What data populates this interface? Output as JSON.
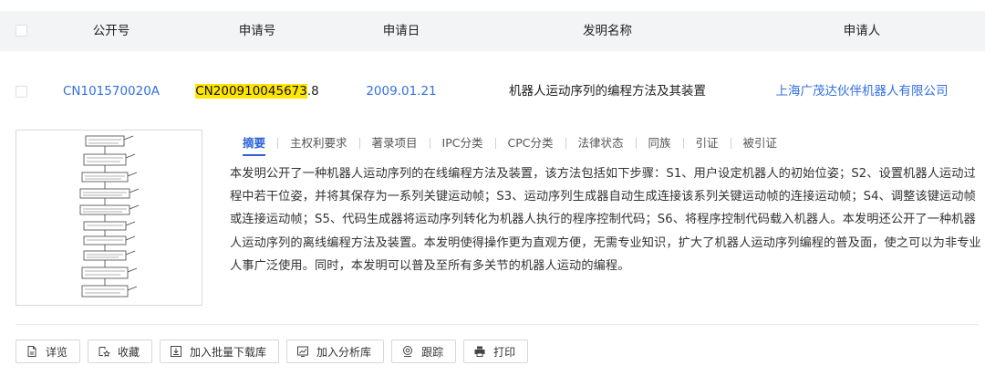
{
  "table": {
    "columns": [
      "公开号",
      "申请号",
      "申请日",
      "发明名称",
      "申请人"
    ]
  },
  "record": {
    "publication_no": "CN101570020A",
    "application_no_highlight": "CN200910045673",
    "application_no_suffix": ".8",
    "application_date": "2009.01.21",
    "title": "机器人运动序列的编程方法及其装置",
    "applicant": "上海广茂达伙伴机器人有限公司"
  },
  "tabs": [
    "摘要",
    "主权利要求",
    "著录项目",
    "IPC分类",
    "CPC分类",
    "法律状态",
    "同族",
    "引证",
    "被引证"
  ],
  "abstract": "本发明公开了一种机器人运动序列的在线编程方法及装置，该方法包括如下步骤：S1、用户设定机器人的初始位姿；S2、设置机器人运动过程中若干位姿，并将其保存为一系列关键运动帧；S3、运动序列生成器自动生成连接该系列关键运动帧的连接运动帧；S4、调整该键运动帧或连接运动帧；S5、代码生成器将运动序列转化为机器人执行的程序控制代码；S6、将程序控制代码载入机器人。本发明还公开了一种机器人运动序列的离线编程方法及装置。本发明使得操作更为直观方便，无需专业知识，扩大了机器人运动序列编程的普及面，使之可以为非专业人事广泛使用。同时，本发明可以普及至所有多关节的机器人运动的编程。",
  "actions": {
    "detail": "详览",
    "favorite": "收藏",
    "batch_download": "加入批量下载库",
    "analysis": "加入分析库",
    "track": "跟踪",
    "print": "打印"
  },
  "colors": {
    "link": "#3370e0",
    "highlight": "#ffe500",
    "tab_active": "#2d63d8"
  }
}
